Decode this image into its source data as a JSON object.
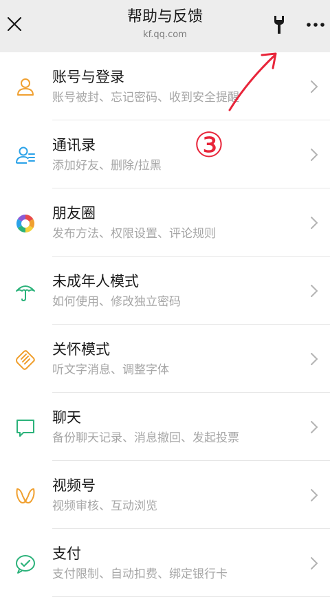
{
  "header": {
    "title": "帮助与反馈",
    "subtitle": "kf.qq.com"
  },
  "items": [
    {
      "label": "账号与登录",
      "desc": "账号被封、忘记密码、收到安全提醒",
      "icon": "user-icon",
      "color": "#f0a030"
    },
    {
      "label": "通讯录",
      "desc": "添加好友、删除/拉黑",
      "icon": "contacts-icon",
      "color": "#2aa2e8"
    },
    {
      "label": "朋友圈",
      "desc": "发布方法、权限设置、评论规则",
      "icon": "moments-icon",
      "color": "#e84a4a"
    },
    {
      "label": "未成年人模式",
      "desc": "如何使用、修改独立密码",
      "icon": "umbrella-icon",
      "color": "#2bb27a"
    },
    {
      "label": "关怀模式",
      "desc": "听文字消息、调整字体",
      "icon": "care-hand-icon",
      "color": "#f0a030"
    },
    {
      "label": "聊天",
      "desc": "备份聊天记录、消息撤回、发起投票",
      "icon": "chat-bubble-icon",
      "color": "#2bb27a"
    },
    {
      "label": "视频号",
      "desc": "视频审核、互动浏览",
      "icon": "channels-icon",
      "color": "#f0a030"
    },
    {
      "label": "支付",
      "desc": "支付限制、自动扣费、绑定银行卡",
      "icon": "pay-icon",
      "color": "#2bb27a"
    }
  ],
  "annotation": {
    "label": "③",
    "color": "#e8253a"
  }
}
